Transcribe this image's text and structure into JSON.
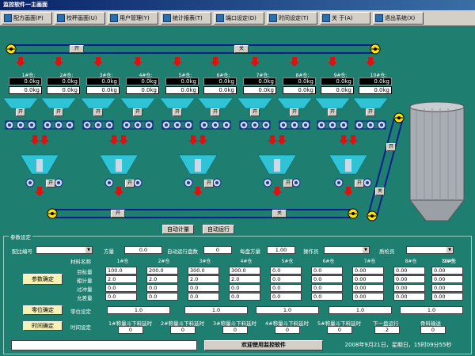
{
  "window": {
    "title": "监控软件一主画面"
  },
  "toolbar": [
    {
      "label": "配方画面(P)",
      "icon": "recipe-icon"
    },
    {
      "label": "校秤画面(U)",
      "icon": "calibrate-icon"
    },
    {
      "label": "用户管理(Y)",
      "icon": "users-icon"
    },
    {
      "label": "统计报表(T)",
      "icon": "report-icon"
    },
    {
      "label": "端口设定(D)",
      "icon": "port-icon"
    },
    {
      "label": "时间设定(T)",
      "icon": "clock-icon"
    },
    {
      "label": "关 于(A)",
      "icon": "about-icon"
    },
    {
      "label": "退出系统(X)",
      "icon": "exit-icon"
    }
  ],
  "scada": {
    "top_conveyor": {
      "open_label": "开",
      "close_label": "关"
    },
    "bins": [
      {
        "name": "1#仓:",
        "weight": "0.0kg",
        "setpoint": "0.0kg",
        "gate": "开"
      },
      {
        "name": "2#仓:",
        "weight": "0.0kg",
        "setpoint": "0.0kg",
        "gate": "开"
      },
      {
        "name": "3#仓:",
        "weight": "0.0kg",
        "setpoint": "0.0kg",
        "gate": "开"
      },
      {
        "name": "4#仓:",
        "weight": "0.0kg",
        "setpoint": "0.0kg",
        "gate": "开"
      },
      {
        "name": "5#仓:",
        "weight": "0.0kg",
        "setpoint": "0.0kg",
        "gate": "开"
      },
      {
        "name": "6#仓:",
        "weight": "0.0kg",
        "setpoint": "0.0kg",
        "gate": "开"
      },
      {
        "name": "7#仓:",
        "weight": "0.0kg",
        "setpoint": "0.0kg",
        "gate": "开"
      },
      {
        "name": "8#仓:",
        "weight": "0.0kg",
        "setpoint": "0.0kg",
        "gate": "开"
      },
      {
        "name": "9#仓:",
        "weight": "0.0kg",
        "setpoint": "0.0kg",
        "gate": "开"
      },
      {
        "name": "10#仓:",
        "weight": "0.0kg",
        "setpoint": "0.0kg",
        "gate": "开"
      }
    ],
    "hoppers": [
      {
        "gate": "开"
      },
      {
        "gate": "开"
      },
      {
        "gate": "开"
      },
      {
        "gate": "开"
      },
      {
        "gate": "开"
      }
    ],
    "bottom_conveyor": {
      "open_label": "开",
      "close_label": "关"
    },
    "incline": {
      "open_label": "开",
      "close_label": "关"
    },
    "auto_weigh_label": "自动计量",
    "auto_run_label": "自动运行"
  },
  "params": {
    "group_title": "参数设定",
    "recipe_no_label": "配比编号",
    "batch_label": "方量",
    "batch_value": "0.0",
    "auto_runs_label": "自动运行盘数",
    "auto_runs_value": "0",
    "per_batch_label": "每盘方量",
    "per_batch_value": "1.00",
    "operator_label": "操作员",
    "inspector_label": "质检员",
    "material_label": "材料名称",
    "bins": [
      "1#仓",
      "2#仓",
      "3#仓",
      "4#仓",
      "5#仓",
      "6#仓",
      "7#仓",
      "8#仓",
      "9#仓",
      "10#仓"
    ],
    "rows": [
      {
        "label": "目标量",
        "values": [
          "100.0",
          "200.0",
          "300.0",
          "300.0",
          "0.0",
          "0.0",
          "0.00",
          "0.00",
          "0.00",
          "0.00"
        ]
      },
      {
        "label": "粗计量",
        "values": [
          "2.0",
          "2.0",
          "2.0",
          "2.0",
          "0.0",
          "0.0",
          "0.00",
          "0.00",
          "0.00",
          "0.00"
        ]
      },
      {
        "label": "过冲量",
        "values": [
          "0.0",
          "0.0",
          "0.0",
          "0.0",
          "0.0",
          "0.0",
          "0.00",
          "0.00",
          "0.00",
          "0.00"
        ]
      },
      {
        "label": "允差量",
        "values": [
          "0.0",
          "0.0",
          "0.0",
          "0.0",
          "0.0",
          "0.0",
          "0.00",
          "0.00",
          "0.00",
          "0.00"
        ]
      }
    ],
    "confirm_params_label": "参数确定",
    "zero_confirm_label": "零位确定",
    "zero_setting_label": "零位设定",
    "zero_values": [
      "1.0",
      "1.0",
      "1.0",
      "1.0",
      "1.0"
    ],
    "time_confirm_label": "时间确定",
    "time_setting_label": "时间设定",
    "hopper_delays": [
      {
        "label": "1#称量斗下料延时",
        "value": "0"
      },
      {
        "label": "2#称量斗下料延时",
        "value": "0"
      },
      {
        "label": "3#称量斗下料延时",
        "value": "0"
      },
      {
        "label": "4#称量斗下料延时",
        "value": "0"
      },
      {
        "label": "5#称量斗下料延时",
        "value": "0"
      }
    ],
    "next_run_label": "下一盘运行",
    "next_run_value": "2",
    "aggregate_delay_label": "骨料输送",
    "aggregate_delay_value": "0"
  },
  "status": {
    "welcome": "欢迎使用监控软件",
    "datetime": "2008年9月21日，星期日，15时09分55秒"
  },
  "colors": {
    "bg": "#1e7e70",
    "bin": "#2ec4d6",
    "arrow": "#e01010",
    "belt": "#0a1e8c"
  }
}
